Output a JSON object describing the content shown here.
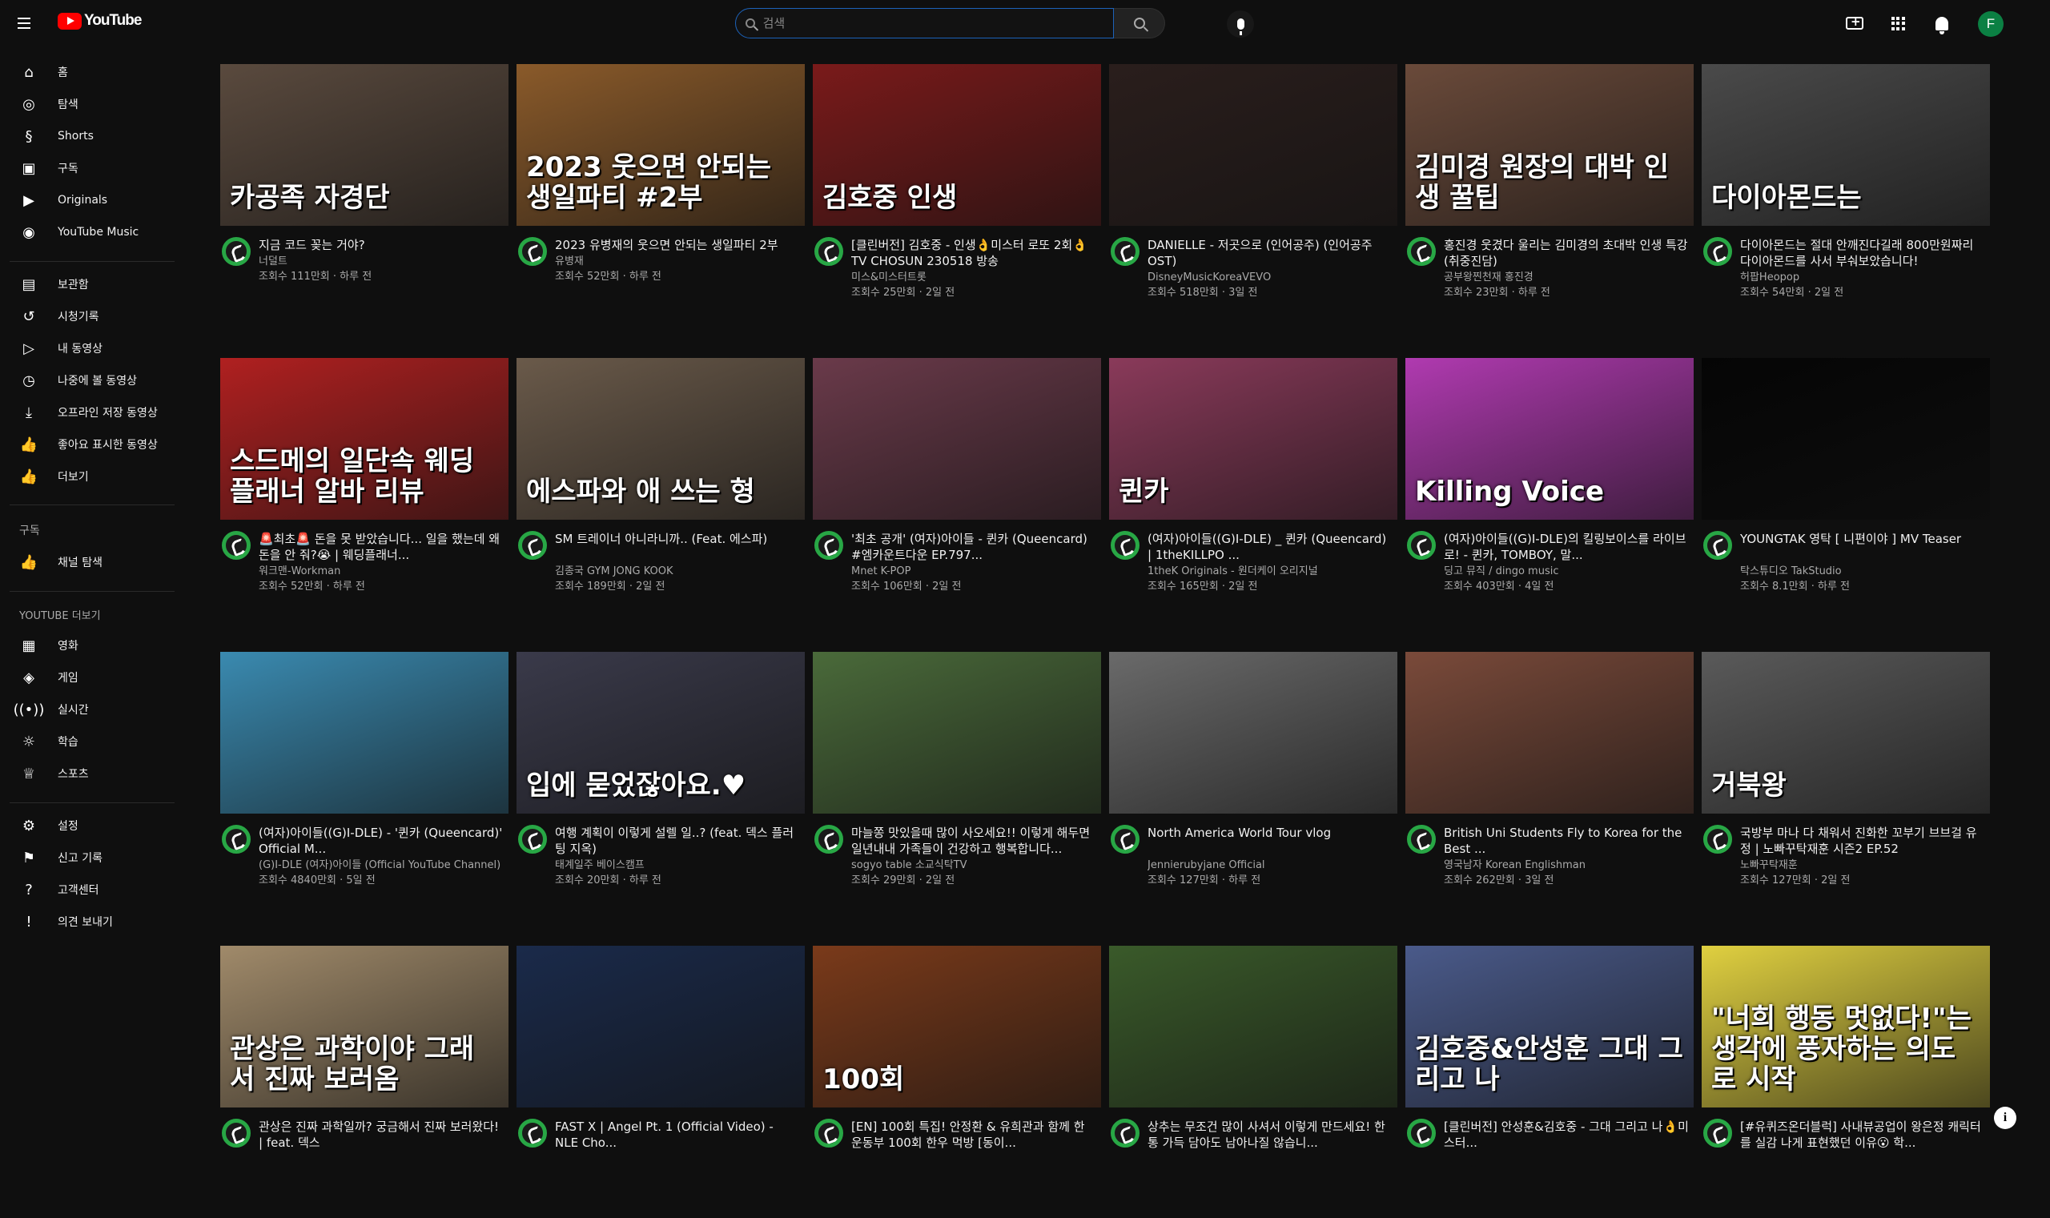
{
  "topbar": {
    "logo_text": "YouTube",
    "search_placeholder": "검색",
    "avatar_letter": "F"
  },
  "sidebar": {
    "group1": [
      "홈",
      "탐색",
      "Shorts",
      "구독",
      "Originals",
      "YouTube Music"
    ],
    "group2": [
      "보관함",
      "시청기록",
      "내 동영상",
      "나중에 볼 동영상",
      "오프라인 저장 동영상",
      "좋아요 표시한 동영상",
      "더보기"
    ],
    "subs_head": "구독",
    "subs": [
      "채널 탐색"
    ],
    "more_head": "YOUTUBE 더보기",
    "more": [
      "영화",
      "게임",
      "실시간",
      "학습",
      "스포츠"
    ],
    "settings": [
      "설정",
      "신고 기록",
      "고객센터",
      "의견 보내기"
    ]
  },
  "videos": [
    {
      "title": "지금 코드 꽂는 거야?",
      "channel": "너덜트",
      "meta": "조회수 111만회 · 하루 전",
      "thumb_text": "카공족 자경단",
      "bg": "#5a4a3e"
    },
    {
      "title": "2023 유병재의 웃으면 안되는 생일파티 2부",
      "channel": "유병재",
      "meta": "조회수 52만회 · 하루 전",
      "thumb_text": "2023 웃으면 안되는 생일파티 #2부",
      "bg": "#8a5a2a"
    },
    {
      "title": "[클린버전] 김호중 - 인생👌미스터 로또 2회👌 TV CHOSUN 230518 방송",
      "channel": "미스&미스터트롯",
      "meta": "조회수 25만회 · 2일 전",
      "thumb_text": "김호중 인생",
      "bg": "#7a1a1a"
    },
    {
      "title": "DANIELLE - 저곳으로 (인어공주) (인어공주 OST)",
      "channel": "DisneyMusicKoreaVEVO",
      "meta": "조회수 518만회 · 3일 전",
      "thumb_text": "",
      "bg": "#2a1e1c"
    },
    {
      "title": "홍진경 웃겼다 울리는 김미경의 초대박 인생 특강(취중진담)",
      "channel": "공부왕찐천재 홍진경",
      "meta": "조회수 23만회 · 하루 전",
      "thumb_text": "김미경 원장의 대박 인생 꿀팁",
      "bg": "#6a4a3a"
    },
    {
      "title": "다이아몬드는 절대 안깨진다길래 800만원짜리 다이아몬드를 사서 부숴보았습니다!",
      "channel": "허팝Heopop",
      "meta": "조회수 54만회 · 2일 전",
      "thumb_text": "다이아몬드는",
      "bg": "#4a4a4a"
    },
    {
      "title": "🚨최초🚨 돈을 못 받았습니다... 일을 했는데 왜 돈을 안 줘?😭 | 웨딩플래너...",
      "channel": "워크맨-Workman",
      "meta": "조회수 52만회 · 하루 전",
      "thumb_text": "스드메의 일단속 웨딩플래너 알바 리뷰",
      "bg": "#b02020"
    },
    {
      "title": "SM 트레이너 아니라니까.. (Feat. 에스파)",
      "channel": "김종국 GYM JONG KOOK",
      "meta": "조회수 189만회 · 2일 전",
      "thumb_text": "에스파와 애 쓰는 형",
      "bg": "#6a5a4a"
    },
    {
      "title": "'최초 공개' (여자)아이들 - 퀸카 (Queencard) #엠카운트다운 EP.797...",
      "channel": "Mnet K-POP",
      "meta": "조회수 106만회 · 2일 전",
      "thumb_text": "",
      "bg": "#6a3a4a"
    },
    {
      "title": "(여자)아이들((G)I-DLE) _ 퀸카 (Queencard) | 1theKILLPO ...",
      "channel": "1theK Originals - 원더케이 오리지널",
      "meta": "조회수 165만회 · 2일 전",
      "thumb_text": "퀸카",
      "bg": "#8a3a5a"
    },
    {
      "title": "(여자)아이들((G)I-DLE)의 킬링보이스를 라이브로! - 퀸카, TOMBOY, 말...",
      "channel": "딩고 뮤직 / dingo music",
      "meta": "조회수 403만회 · 4일 전",
      "thumb_text": "Killing Voice",
      "bg": "#b03ab0"
    },
    {
      "title": "YOUNGTAK 영탁 [ 니편이야 ] MV Teaser",
      "channel": "탁스튜디오 TakStudio",
      "meta": "조회수 8.1만회 · 하루 전",
      "thumb_text": "",
      "bg": "#050505"
    },
    {
      "title": "(여자)아이들((G)I-DLE) - '퀸카 (Queencard)' Official M...",
      "channel": "(G)I-DLE (여자)아이들 (Official YouTube Channel)",
      "meta": "조회수 4840만회 · 5일 전",
      "thumb_text": "",
      "bg": "#3a8ab0"
    },
    {
      "title": "여행 계획이 이렇게 설렐 일..? (feat. 덱스 플러팅 지옥)",
      "channel": "태계일주 베이스캠프",
      "meta": "조회수 20만회 · 하루 전",
      "thumb_text": "입에 묻었잖아요.♥",
      "bg": "#3a3a4a"
    },
    {
      "title": "마늘쫑 맛있을때 많이 사오세요!! 이렇게 해두면 일년내내 가족들이 건강하고 행복합니다...",
      "channel": "sogyo table 소교식탁TV",
      "meta": "조회수 29만회 · 2일 전",
      "thumb_text": "",
      "bg": "#4a6a3a"
    },
    {
      "title": "North America World Tour vlog",
      "channel": "Jennierubyjane Official",
      "meta": "조회수 127만회 · 하루 전",
      "thumb_text": "",
      "bg": "#6a6a6a"
    },
    {
      "title": "British Uni Students Fly to Korea for the Best ...",
      "channel": "영국남자 Korean Englishman",
      "meta": "조회수 262만회 · 3일 전",
      "thumb_text": "",
      "bg": "#7a4a3a"
    },
    {
      "title": "국방부 마나 다 채워서 진화한 꼬부기 브브걸 유정 | 노빠꾸탁재훈 시즌2 EP.52",
      "channel": "노빠꾸탁재훈",
      "meta": "조회수 127만회 · 2일 전",
      "thumb_text": "거북왕",
      "bg": "#5a5a5a"
    },
    {
      "title": "관상은 진짜 과학일까? 궁금해서 진짜 보러왔다! | feat. 덱스",
      "channel": "",
      "meta": "",
      "thumb_text": "관상은 과학이야 그래서 진짜 보러옴",
      "bg": "#a08a6a"
    },
    {
      "title": "FAST X | Angel Pt. 1 (Official Video) - NLE Cho...",
      "channel": "",
      "meta": "",
      "thumb_text": "",
      "bg": "#1a2a4a"
    },
    {
      "title": "[EN] 100회 특집! 안정환 & 유희관과 함께 한 운동부 100회 한우 먹방 [동이...",
      "channel": "",
      "meta": "",
      "thumb_text": "100회",
      "bg": "#7a3a1a"
    },
    {
      "title": "상추는 무조건 많이 사셔서 이렇게 만드세요! 한통 가득 담아도 남아나질 않습니...",
      "channel": "",
      "meta": "",
      "thumb_text": "",
      "bg": "#3a5a2a"
    },
    {
      "title": "[클린버전] 안성훈&김호중 - 그대 그리고 나👌미스터...",
      "channel": "",
      "meta": "",
      "thumb_text": "김호중&안성훈 그대 그리고 나",
      "bg": "#4a5a8a"
    },
    {
      "title": "[#유퀴즈온더블럭] 사내뷰공업이 왕은정 캐릭터를 실감 나게 표현했던 이유😮 학...",
      "channel": "",
      "meta": "",
      "thumb_text": "\"너희 행동 멋없다!\"는 생각에 풍자하는 의도로 시작",
      "bg": "#e0d040"
    }
  ],
  "info_button": "i"
}
